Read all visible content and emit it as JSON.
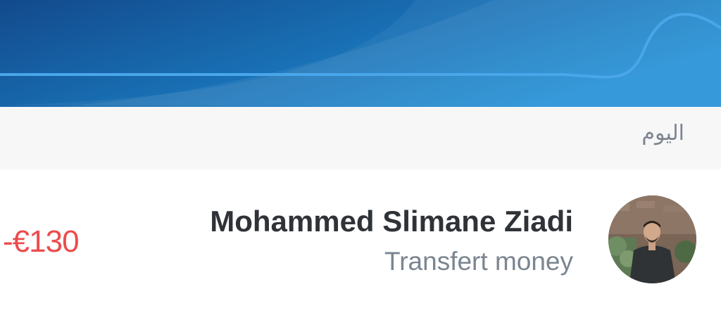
{
  "header": {
    "gradient_start": "#124a8c",
    "gradient_end": "#1f8fd6",
    "wave_color": "#4aa6ea"
  },
  "section": {
    "label": "اليوم"
  },
  "transaction": {
    "amount": "-€130",
    "name": "Mohammed Slimane Ziadi",
    "subtitle": "Transfert money",
    "amount_color": "#ec4c4c",
    "avatar_icon": "user-photo"
  }
}
